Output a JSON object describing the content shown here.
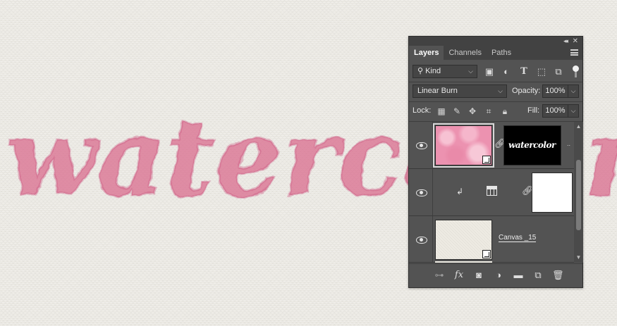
{
  "canvas": {
    "word": "watercolor"
  },
  "panel": {
    "tabs": [
      {
        "label": "Layers",
        "active": true
      },
      {
        "label": "Channels",
        "active": false
      },
      {
        "label": "Paths",
        "active": false
      }
    ],
    "filter": {
      "kind_label": "Kind",
      "icons": [
        "image-filter-icon",
        "adjustment-filter-icon",
        "type-filter-icon",
        "shape-filter-icon",
        "smart-object-filter-icon"
      ]
    },
    "blend": {
      "mode": "Linear Burn",
      "opacity_label": "Opacity:",
      "opacity_value": "100%"
    },
    "lock": {
      "label": "Lock:",
      "icons": [
        "lock-transparent-icon",
        "lock-pixels-icon",
        "lock-position-icon",
        "lock-artboard-icon",
        "lock-all-icon"
      ],
      "fill_label": "Fill:",
      "fill_value": "100%"
    },
    "layers": [
      {
        "kind": "smart-object-with-mask",
        "mask_text": "watercolor",
        "visible": true,
        "selected": true
      },
      {
        "kind": "adjustment-with-mask",
        "visible": true,
        "clipped": true
      },
      {
        "kind": "smart-object",
        "name": "Canvas _15",
        "visible": true
      }
    ],
    "bottom_icons": [
      "link-layers-icon",
      "fx-icon",
      "add-mask-icon",
      "adjustment-layer-icon",
      "group-folder-icon",
      "new-layer-icon",
      "trash-icon"
    ],
    "colors": {
      "panel_bg": "#535353",
      "canvas_bg": "#eceae4",
      "watercolor_pink": "#d9678a"
    }
  }
}
